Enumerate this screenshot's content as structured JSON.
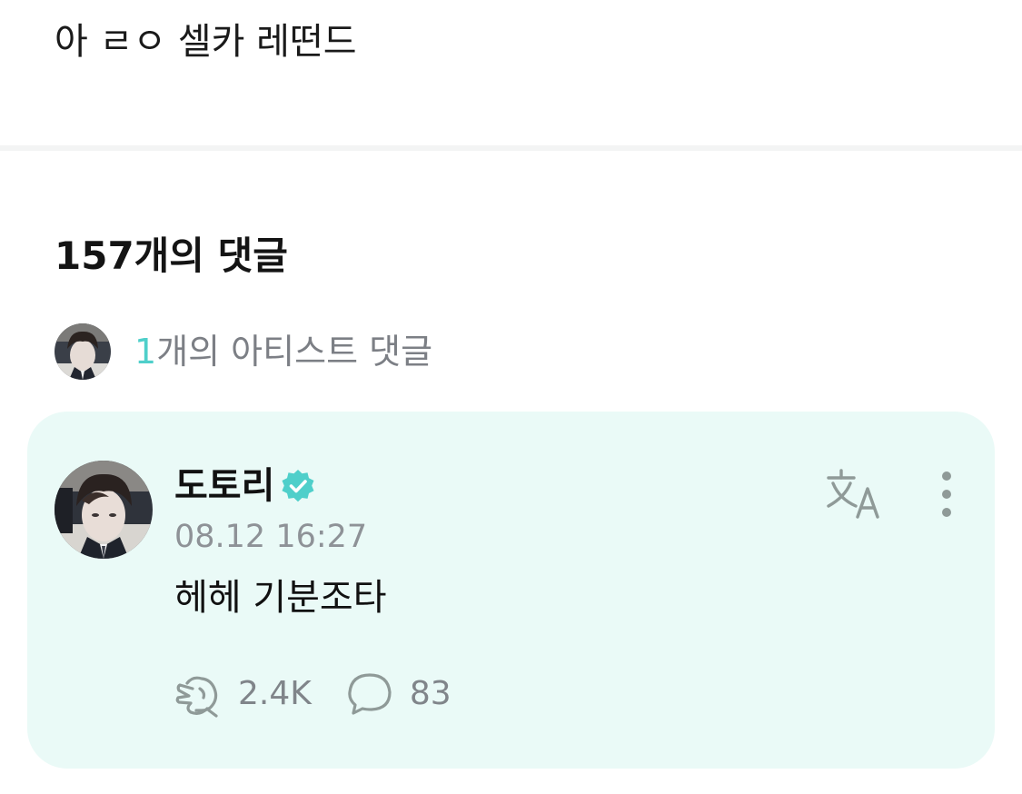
{
  "post": {
    "text": "아 ㄹㅇ 셀카 레떤드"
  },
  "comments_section": {
    "heading": "157개의 댓글",
    "artist_comments": {
      "count": "1",
      "label": "개의 아티스트 댓글"
    }
  },
  "comment": {
    "author": "도토리",
    "verified": true,
    "timestamp": "08.12 16:27",
    "body": "헤헤 기분조타",
    "likes": "2.4K",
    "replies": "83",
    "icons": {
      "like": "clapping-hands-icon",
      "reply": "speech-bubble-icon",
      "translate": "translate-icon",
      "more": "more-vertical-icon",
      "badge": "verified-badge-icon"
    }
  },
  "colors": {
    "accent": "#4fcfca",
    "card_background": "#eafaf7",
    "muted_text": "#8e9297",
    "icon_gray": "#8f9a98"
  }
}
